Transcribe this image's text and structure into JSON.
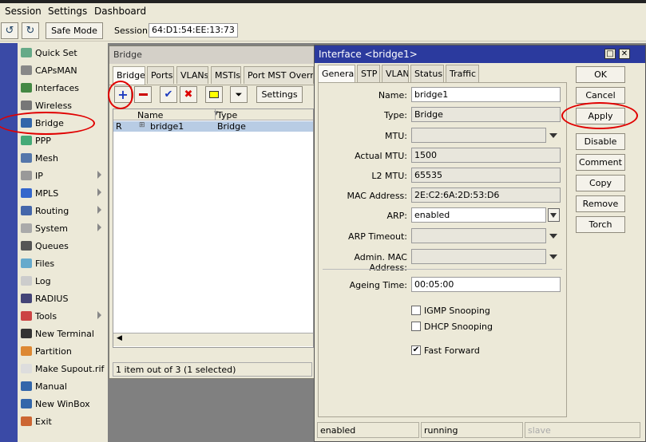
{
  "menu": {
    "session": "Session",
    "settings": "Settings",
    "dashboard": "Dashboard"
  },
  "toolbar": {
    "safe_mode": "Safe Mode",
    "session_label": "Session:",
    "session_value": "64:D1:54:EE:13:73"
  },
  "sidebar": {
    "items": [
      {
        "label": "Quick Set",
        "icon": "quick-set-icon",
        "color": "#6a8"
      },
      {
        "label": "CAPsMAN",
        "icon": "capsman-icon",
        "color": "#888"
      },
      {
        "label": "Interfaces",
        "icon": "interfaces-icon",
        "color": "#484"
      },
      {
        "label": "Wireless",
        "icon": "wireless-icon",
        "color": "#777"
      },
      {
        "label": "Bridge",
        "icon": "bridge-icon",
        "color": "#36a"
      },
      {
        "label": "PPP",
        "icon": "ppp-icon",
        "color": "#4a7"
      },
      {
        "label": "Mesh",
        "icon": "mesh-icon",
        "color": "#57a"
      },
      {
        "label": "IP",
        "icon": "ip-icon",
        "color": "#999",
        "arrow": true
      },
      {
        "label": "MPLS",
        "icon": "mpls-icon",
        "color": "#36c",
        "arrow": true
      },
      {
        "label": "Routing",
        "icon": "routing-icon",
        "color": "#46a",
        "arrow": true
      },
      {
        "label": "System",
        "icon": "system-icon",
        "color": "#aaa",
        "arrow": true
      },
      {
        "label": "Queues",
        "icon": "queues-icon",
        "color": "#555"
      },
      {
        "label": "Files",
        "icon": "files-icon",
        "color": "#6ac"
      },
      {
        "label": "Log",
        "icon": "log-icon",
        "color": "#ccc"
      },
      {
        "label": "RADIUS",
        "icon": "radius-icon",
        "color": "#447"
      },
      {
        "label": "Tools",
        "icon": "tools-icon",
        "color": "#c44",
        "arrow": true
      },
      {
        "label": "New Terminal",
        "icon": "terminal-icon",
        "color": "#333"
      },
      {
        "label": "Partition",
        "icon": "partition-icon",
        "color": "#d83"
      },
      {
        "label": "Make Supout.rif",
        "icon": "supout-icon",
        "color": "#ddd"
      },
      {
        "label": "Manual",
        "icon": "manual-icon",
        "color": "#36a"
      },
      {
        "label": "New WinBox",
        "icon": "winbox-icon",
        "color": "#36a"
      },
      {
        "label": "Exit",
        "icon": "exit-icon",
        "color": "#c63"
      }
    ]
  },
  "bridge_window": {
    "title": "Bridge",
    "tabs": [
      "Bridge",
      "Ports",
      "VLANs",
      "MSTIs",
      "Port MST Override"
    ],
    "settings": "Settings",
    "columns": [
      "Name",
      "Type"
    ],
    "rows": [
      {
        "flag": "R",
        "name": "bridge1",
        "type": "Bridge"
      }
    ],
    "status": "1 item out of 3 (1 selected)"
  },
  "interface_window": {
    "title": "Interface <bridge1>",
    "tabs": [
      "General",
      "STP",
      "VLAN",
      "Status",
      "Traffic"
    ],
    "fields": {
      "name_label": "Name:",
      "name": "bridge1",
      "type_label": "Type:",
      "type": "Bridge",
      "mtu_label": "MTU:",
      "mtu": "",
      "actual_mtu_label": "Actual MTU:",
      "actual_mtu": "1500",
      "l2mtu_label": "L2 MTU:",
      "l2mtu": "65535",
      "mac_label": "MAC Address:",
      "mac": "2E:C2:6A:2D:53:D6",
      "arp_label": "ARP:",
      "arp": "enabled",
      "arp_timeout_label": "ARP Timeout:",
      "arp_timeout": "",
      "admin_mac_label": "Admin. MAC Address:",
      "admin_mac": "",
      "ageing_label": "Ageing Time:",
      "ageing": "00:05:00"
    },
    "checkboxes": {
      "igmp": "IGMP Snooping",
      "dhcp": "DHCP Snooping",
      "fast_forward": "Fast Forward"
    },
    "buttons": {
      "ok": "OK",
      "cancel": "Cancel",
      "apply": "Apply",
      "disable": "Disable",
      "comment": "Comment",
      "copy": "Copy",
      "remove": "Remove",
      "torch": "Torch"
    },
    "status": [
      "enabled",
      "running",
      "slave"
    ]
  }
}
